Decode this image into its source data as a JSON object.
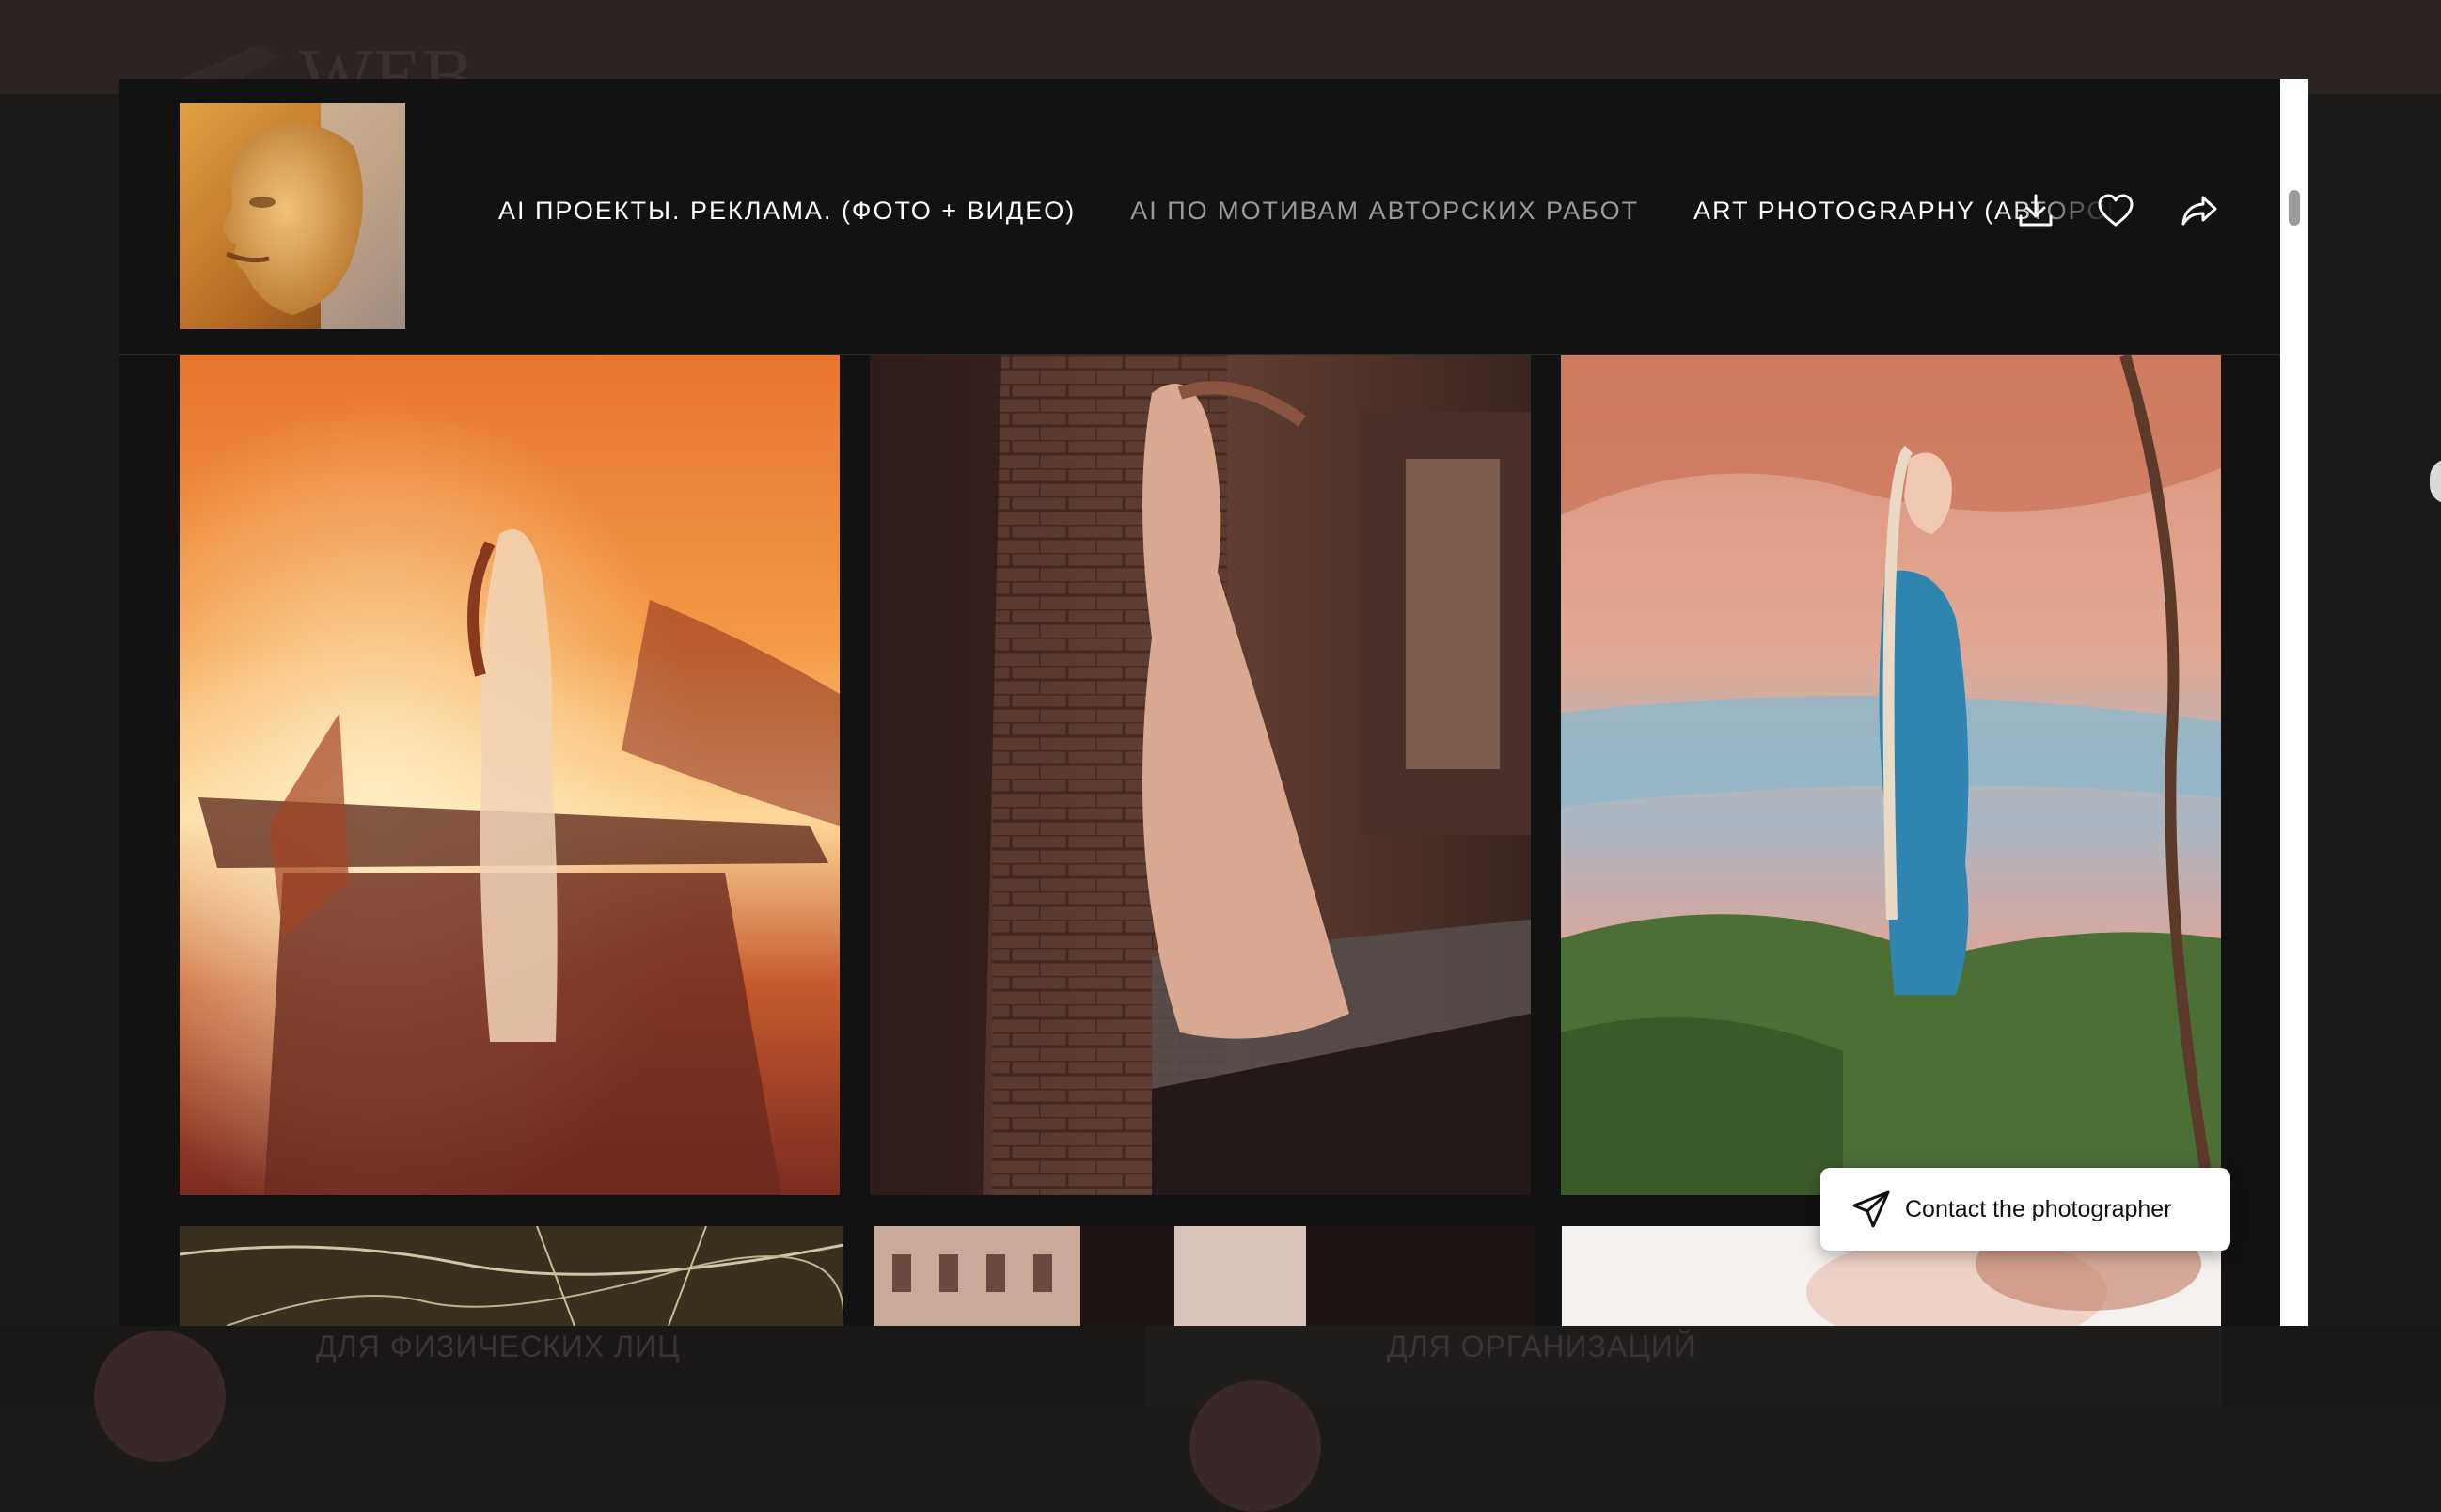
{
  "background_page": {
    "logo_text": "WEB",
    "section_left": "ДЛЯ ФИЗИЧЕСКИХ ЛИЦ",
    "section_right": "ДЛЯ ОРГАНИЗАЦИЙ"
  },
  "modal": {
    "nav": [
      {
        "label": "AI ПРОЕКТЫ. РЕКЛАМА. (ФОТО + ВИДЕО)",
        "active": true
      },
      {
        "label": "AI ПО МОТИВАМ АВТОРСКИХ РАБОТ",
        "active": false
      },
      {
        "label": "ART PHOTOGRAPHY (АВТОРСКИЕ РАБОТЫ)",
        "active": true
      }
    ],
    "icons": {
      "download": "download-icon",
      "favorite": "heart-icon",
      "share": "share-icon"
    },
    "contact_button": {
      "label": "Contact the photographer",
      "icon": "paper-plane-icon"
    },
    "photos": [
      {
        "id": "sunset-woman-stairs",
        "palette": [
          "#f7c06a",
          "#e0622b",
          "#6e2418"
        ]
      },
      {
        "id": "woman-brick-wall",
        "palette": [
          "#c99b83",
          "#5d3a30",
          "#2a1a1a"
        ]
      },
      {
        "id": "woman-blue-dress-river",
        "palette": [
          "#e7a38a",
          "#5b8fae",
          "#4b6b3a"
        ]
      },
      {
        "id": "gold-cracked-texture",
        "palette": [
          "#3a3020",
          "#d0c6a6"
        ]
      },
      {
        "id": "arch-building",
        "palette": [
          "#caa89a",
          "#1e1414"
        ]
      },
      {
        "id": "pale-leaves",
        "palette": [
          "#f4f0ee",
          "#c27a63"
        ]
      }
    ]
  }
}
